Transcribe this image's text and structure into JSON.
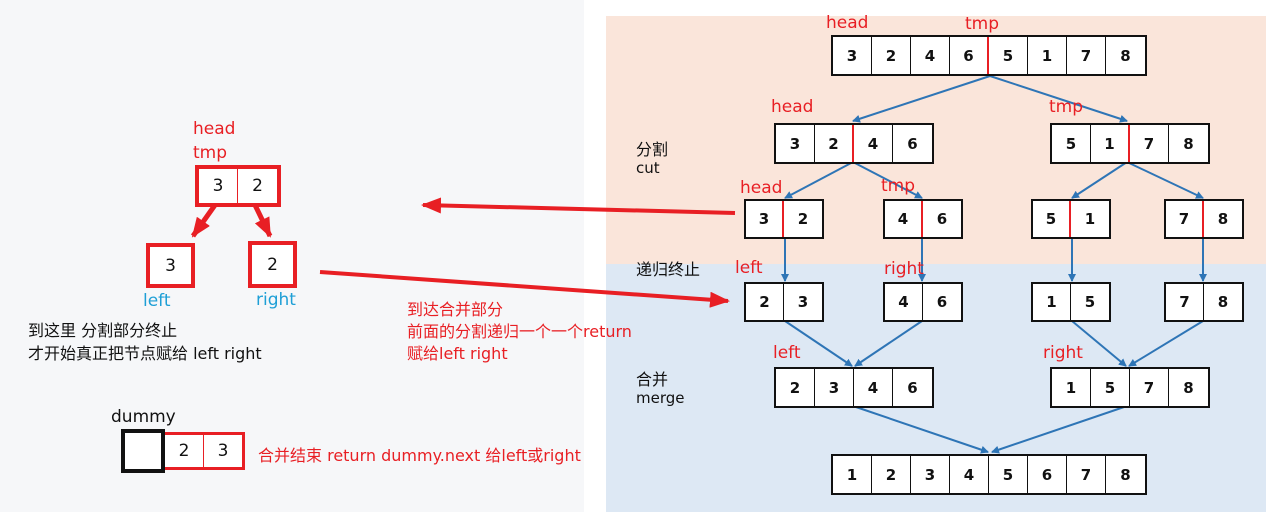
{
  "left_panel": {
    "pair_labels": [
      "head",
      "tmp"
    ],
    "pair_values": [
      "3",
      "2"
    ],
    "single_left_value": "3",
    "single_right_value": "2",
    "left_caption": "left",
    "right_caption": "right",
    "note_line1": "到这里 分割部分终止",
    "note_line2": "才开始真正把节点赋给 left right",
    "dummy_label": "dummy",
    "dummy_values": [
      "",
      "2",
      "3"
    ],
    "merge_end_note": "合并结束 return dummy.next  给left或right"
  },
  "middle_note": {
    "line1": "到达合并部分",
    "line2": "前面的分割递归一个一个return",
    "line3": "赋给left right"
  },
  "diagram": {
    "colors": {
      "cut_bg": "#fae5da",
      "merge_bg": "#dde8f4",
      "red": "#e81f24",
      "blue": "#2e75b6"
    },
    "sections": {
      "cut_label": "分割",
      "cut_label_en": "cut",
      "stop_label": "递归终止",
      "merge_label": "合并",
      "merge_label_en": "merge"
    },
    "level0": {
      "values": [
        "3",
        "2",
        "4",
        "6",
        "5",
        "1",
        "7",
        "8"
      ],
      "head": "head",
      "tmp": "tmp"
    },
    "level1": {
      "left_values": [
        "3",
        "2",
        "4",
        "6"
      ],
      "right_values": [
        "5",
        "1",
        "7",
        "8"
      ],
      "head": "head",
      "tmp": "tmp"
    },
    "level2": {
      "a": [
        "3",
        "2"
      ],
      "b": [
        "4",
        "6"
      ],
      "c": [
        "5",
        "1"
      ],
      "d": [
        "7",
        "8"
      ],
      "head": "head",
      "tmp": "tmp"
    },
    "level3": {
      "a": [
        "2",
        "3"
      ],
      "b": [
        "4",
        "6"
      ],
      "c": [
        "1",
        "5"
      ],
      "d": [
        "7",
        "8"
      ],
      "left": "left",
      "right": "right"
    },
    "level4": {
      "left_values": [
        "2",
        "3",
        "4",
        "6"
      ],
      "right_values": [
        "1",
        "5",
        "7",
        "8"
      ],
      "left": "left",
      "right": "right"
    },
    "level5": {
      "values": [
        "1",
        "2",
        "3",
        "4",
        "5",
        "6",
        "7",
        "8"
      ]
    }
  }
}
